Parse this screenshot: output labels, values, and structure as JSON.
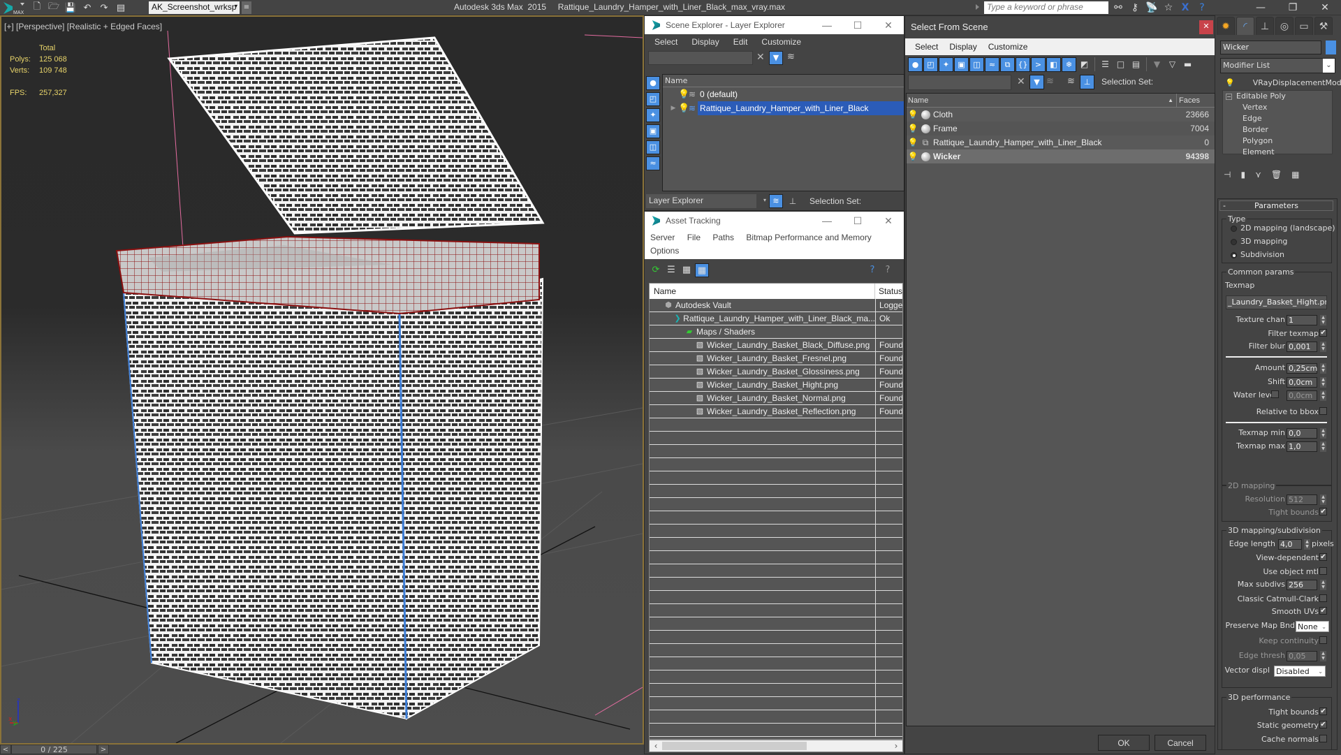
{
  "titlebar": {
    "logo_text": "MAX",
    "workspace": "AK_Screenshot_wrksp",
    "app_title": "Autodesk 3ds Max  2015     Rattique_Laundry_Hamper_with_Liner_Black_max_vray.max",
    "search_placeholder": "Type a keyword or phrase",
    "qa_icons": [
      "new-file-icon",
      "open-file-icon",
      "save-icon",
      "undo-icon",
      "redo-icon",
      "project-folder-icon"
    ],
    "tool_icons": [
      "binoculars-icon",
      "key-icon",
      "satellite-icon",
      "star-icon",
      "x-icon",
      "help-icon"
    ]
  },
  "viewport": {
    "label": "[+] [Perspective] [Realistic + Edged Faces]",
    "stats": {
      "header": "Total",
      "polys_label": "Polys:",
      "polys": "125 068",
      "verts_label": "Verts:",
      "verts": "109 748",
      "fps_label": "FPS:",
      "fps": "257,327"
    },
    "axis": {
      "x": "x",
      "y": "y",
      "z": "z"
    }
  },
  "timeslider": {
    "prev": "<",
    "value": "0 / 225",
    "next": ">"
  },
  "scene_explorer": {
    "title": "Scene Explorer - Layer Explorer",
    "menu": [
      "Select",
      "Display",
      "Edit",
      "Customize"
    ],
    "column_name": "Name",
    "layers": [
      {
        "name": "0 (default)",
        "selected": false,
        "expandable": false
      },
      {
        "name": "Rattique_Laundry_Hamper_with_Liner_Black",
        "selected": true,
        "expandable": true
      }
    ],
    "mode": "Layer Explorer",
    "selection_set_label": "Selection Set:"
  },
  "asset_tracking": {
    "title": "Asset Tracking",
    "menu": [
      "Server",
      "File",
      "Paths",
      "Bitmap Performance and Memory",
      "Options"
    ],
    "columns": [
      "Name",
      "Status"
    ],
    "rows": [
      {
        "name": "Autodesk Vault",
        "status": "Logged",
        "indent": 0,
        "icon": "vault-icon"
      },
      {
        "name": "Rattique_Laundry_Hamper_with_Liner_Black_ma...",
        "status": "Ok",
        "indent": 1,
        "icon": "max-file-icon"
      },
      {
        "name": "Maps / Shaders",
        "status": "",
        "indent": 2,
        "icon": "maps-icon"
      },
      {
        "name": "Wicker_Laundry_Basket_Black_Diffuse.png",
        "status": "Found",
        "indent": 3,
        "icon": "bitmap-icon"
      },
      {
        "name": "Wicker_Laundry_Basket_Fresnel.png",
        "status": "Found",
        "indent": 3,
        "icon": "bitmap-icon"
      },
      {
        "name": "Wicker_Laundry_Basket_Glossiness.png",
        "status": "Found",
        "indent": 3,
        "icon": "bitmap-icon"
      },
      {
        "name": "Wicker_Laundry_Basket_Hight.png",
        "status": "Found",
        "indent": 3,
        "icon": "bitmap-icon"
      },
      {
        "name": "Wicker_Laundry_Basket_Normal.png",
        "status": "Found",
        "indent": 3,
        "icon": "bitmap-icon"
      },
      {
        "name": "Wicker_Laundry_Basket_Reflection.png",
        "status": "Found",
        "indent": 3,
        "icon": "bitmap-icon"
      }
    ],
    "empty_rows": 24
  },
  "select_from_scene": {
    "title": "Select From Scene",
    "menu": [
      "Select",
      "Display",
      "Customize"
    ],
    "selection_set_label": "Selection Set:",
    "columns": [
      "Name",
      "Faces"
    ],
    "rows": [
      {
        "name": "Cloth",
        "faces": "23666",
        "selected": false,
        "type": "geometry"
      },
      {
        "name": "Frame",
        "faces": "7004",
        "selected": false,
        "type": "geometry"
      },
      {
        "name": "Rattique_Laundry_Hamper_with_Liner_Black",
        "faces": "0",
        "selected": false,
        "type": "group"
      },
      {
        "name": "Wicker",
        "faces": "94398",
        "selected": true,
        "type": "geometry"
      }
    ],
    "ok_label": "OK",
    "cancel_label": "Cancel"
  },
  "command_panel": {
    "object_name": "Wicker",
    "object_color": "#4a90e2",
    "modifier_list_label": "Modifier List",
    "stack": {
      "top_modifier": "VRayDisplacementMod",
      "base": "Editable Poly",
      "sub_objects": [
        "Vertex",
        "Edge",
        "Border",
        "Polygon",
        "Element"
      ]
    },
    "rollout_title": "Parameters",
    "type": {
      "label": "Type",
      "options": [
        {
          "label": "2D mapping (landscape)",
          "selected": false
        },
        {
          "label": "3D mapping",
          "selected": false
        },
        {
          "label": "Subdivision",
          "selected": true
        }
      ]
    },
    "common": {
      "label": "Common params",
      "texmap_label": "Texmap",
      "texmap_value": "_Laundry_Basket_Hight.png)",
      "texture_chan_label": "Texture chan",
      "texture_chan": "1",
      "filter_texmap_label": "Filter texmap",
      "filter_texmap": true,
      "filter_blur_label": "Filter blur",
      "filter_blur": "0,001",
      "amount_label": "Amount",
      "amount": "0,25cm",
      "shift_label": "Shift",
      "shift": "0,0cm",
      "water_level_label": "Water level",
      "water_level_enabled": false,
      "water_level": "0,0cm",
      "relative_bbox_label": "Relative to bbox",
      "relative_bbox": false,
      "texmap_min_label": "Texmap min",
      "texmap_min": "0,0",
      "texmap_max_label": "Texmap max",
      "texmap_max": "1,0"
    },
    "mapping_2d": {
      "label": "2D mapping",
      "resolution_label": "Resolution",
      "resolution": "512",
      "tight_bounds_label": "Tight bounds",
      "tight_bounds": true
    },
    "mapping_3d": {
      "label": "3D mapping/subdivision",
      "edge_length_label": "Edge length",
      "edge_length": "4,0",
      "edge_unit": "pixels",
      "view_dependent_label": "View-dependent",
      "view_dependent": true,
      "use_object_mtl_label": "Use object mtl",
      "use_object_mtl": false,
      "max_subdivs_label": "Max subdivs",
      "max_subdivs": "256",
      "catmull_label": "Classic Catmull-Clark",
      "catmull": false,
      "smooth_uvs_label": "Smooth UVs",
      "smooth_uvs": true,
      "preserve_map_label": "Preserve Map Bnd",
      "preserve_map": "None",
      "keep_continuity_label": "Keep continuity",
      "keep_continuity": false,
      "edge_thresh_label": "Edge thresh",
      "edge_thresh": "0,05",
      "vector_displ_label": "Vector displ",
      "vector_displ": "Disabled"
    },
    "perf_3d": {
      "label": "3D performance",
      "tight_bounds_label": "Tight bounds",
      "tight_bounds": true,
      "static_geo_label": "Static geometry",
      "static_geo": true,
      "cache_normals_label": "Cache normals",
      "cache_normals": false
    }
  }
}
